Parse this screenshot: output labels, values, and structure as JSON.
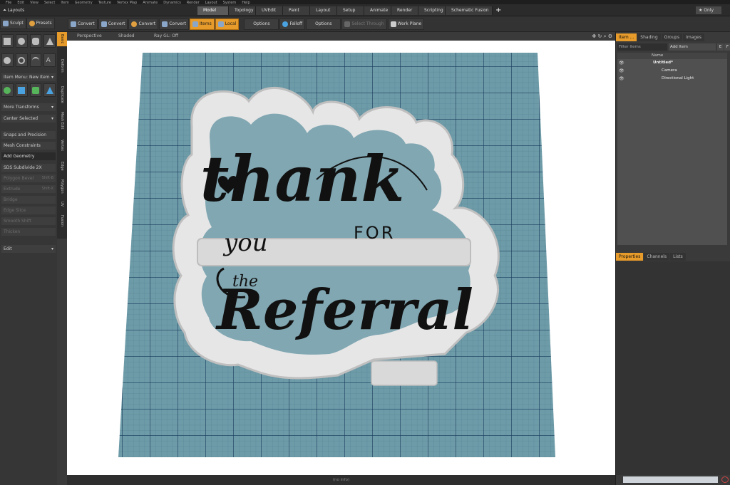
{
  "menubar": {
    "items": [
      "File",
      "Edit",
      "View",
      "Select",
      "Item",
      "Geometry",
      "Texture",
      "Vertex Map",
      "Animate",
      "Dynamics",
      "Render",
      "Layout",
      "System",
      "Help"
    ]
  },
  "layouts_label": "Layouts",
  "tabs": [
    {
      "label": "Model",
      "active": true
    },
    {
      "label": "Topology"
    },
    {
      "label": "UVEdit"
    },
    {
      "label": "Paint"
    },
    {
      "label": "Layout"
    },
    {
      "label": "Setup"
    },
    {
      "label": "Animate"
    },
    {
      "label": "Render"
    },
    {
      "label": "Scripting"
    },
    {
      "label": "Schematic Fusion"
    }
  ],
  "only_label": "Only",
  "toolbar": {
    "sculpt": "Sculpt",
    "presets": "Presets",
    "convert1": "Convert",
    "convert2": "Convert",
    "convert3": "Convert",
    "convert4": "Convert",
    "items": "Items",
    "local": "Local",
    "options1": "Options",
    "falloff": "Falloff",
    "options2": "Options",
    "select_through": "Select Through",
    "work_plane": "Work Plane"
  },
  "left_tabs": [
    "Basic",
    "Deform",
    "Duplicate",
    "Mesh Edit",
    "Vertex",
    "Edge",
    "Polygon",
    "UV",
    "Fusion"
  ],
  "left_panel": {
    "item_menu": "Item Menu: New Item",
    "more_transforms": "More Transforms",
    "center_selected": "Center Selected",
    "snaps": "Snaps and Precision",
    "mesh_constraints": "Mesh Constraints",
    "add_geometry": "Add Geometry",
    "sds_subdivide": "SDS Subdivide 2X",
    "polygon_bevel": "Polygon Bevel",
    "polygon_bevel_key": "Shift-B",
    "extrude": "Extrude",
    "extrude_key": "Shift-X",
    "bridge": "Bridge",
    "edge_slice": "Edge Slice",
    "smooth_shift": "Smooth Shift",
    "thicken": "Thicken",
    "edit": "Edit"
  },
  "viewport": {
    "perspective": "Perspective",
    "shaded": "Shaded",
    "raygl": "Ray GL: Off"
  },
  "artwork": {
    "thank": "thank",
    "you": "you",
    "for": "FOR",
    "the": "the",
    "referral": "Referral"
  },
  "right_panel": {
    "tabs": [
      "Item ...",
      "Shading",
      "Groups",
      "Images"
    ],
    "filter_placeholder": "Filter Items",
    "add_item": "Add Item",
    "e_btn": "E",
    "f_btn": "F",
    "name_col": "Name",
    "tree": [
      {
        "label": "Untitled*",
        "depth": 0
      },
      {
        "label": "Camera",
        "depth": 1
      },
      {
        "label": "Directional Light",
        "depth": 1
      }
    ],
    "bottom_tabs": [
      "Properties",
      "Channels",
      "Lists"
    ]
  },
  "status": "(no info)"
}
